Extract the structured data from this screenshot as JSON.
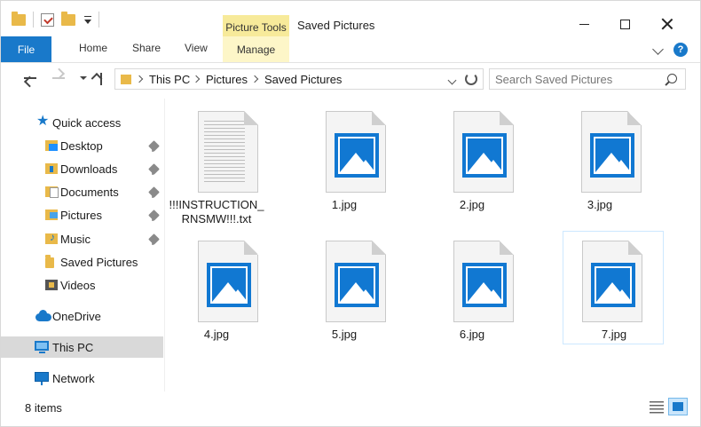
{
  "titlebar": {
    "context_tab_title": "Picture Tools",
    "window_title": "Saved Pictures"
  },
  "ribbon": {
    "tabs": [
      "File",
      "Home",
      "Share",
      "View",
      "Manage"
    ],
    "help": "?"
  },
  "address": {
    "crumbs": [
      "This PC",
      "Pictures",
      "Saved Pictures"
    ],
    "search_placeholder": "Search Saved Pictures"
  },
  "sidebar": {
    "items": [
      {
        "label": "Quick access",
        "icon": "star-icon",
        "pinned": false
      },
      {
        "label": "Desktop",
        "icon": "desktop-folder-icon",
        "pinned": true
      },
      {
        "label": "Downloads",
        "icon": "downloads-folder-icon",
        "pinned": true
      },
      {
        "label": "Documents",
        "icon": "documents-folder-icon",
        "pinned": true
      },
      {
        "label": "Pictures",
        "icon": "pictures-folder-icon",
        "pinned": true
      },
      {
        "label": "Music",
        "icon": "music-folder-icon",
        "pinned": true
      },
      {
        "label": "Saved Pictures",
        "icon": "folder-icon",
        "pinned": false
      },
      {
        "label": "Videos",
        "icon": "videos-folder-icon",
        "pinned": false
      },
      {
        "label": "OneDrive",
        "icon": "onedrive-icon",
        "pinned": false
      },
      {
        "label": "This PC",
        "icon": "this-pc-icon",
        "pinned": false,
        "selected": true
      },
      {
        "label": "Network",
        "icon": "network-icon",
        "pinned": false
      }
    ]
  },
  "files": [
    {
      "name_line1": "!!!INSTRUCTION_",
      "name_line2": "RNSMW!!!.txt",
      "type": "text"
    },
    {
      "name_line1": "1.jpg",
      "name_line2": "",
      "type": "image"
    },
    {
      "name_line1": "2.jpg",
      "name_line2": "",
      "type": "image"
    },
    {
      "name_line1": "3.jpg",
      "name_line2": "",
      "type": "image"
    },
    {
      "name_line1": "4.jpg",
      "name_line2": "",
      "type": "image"
    },
    {
      "name_line1": "5.jpg",
      "name_line2": "",
      "type": "image"
    },
    {
      "name_line1": "6.jpg",
      "name_line2": "",
      "type": "image"
    },
    {
      "name_line1": "7.jpg",
      "name_line2": "",
      "type": "image",
      "selected": true
    }
  ],
  "status": {
    "item_count": "8 items"
  },
  "colors": {
    "accent": "#1979ca",
    "picture_tools": "#f7ea9a",
    "folder": "#e9b949"
  }
}
